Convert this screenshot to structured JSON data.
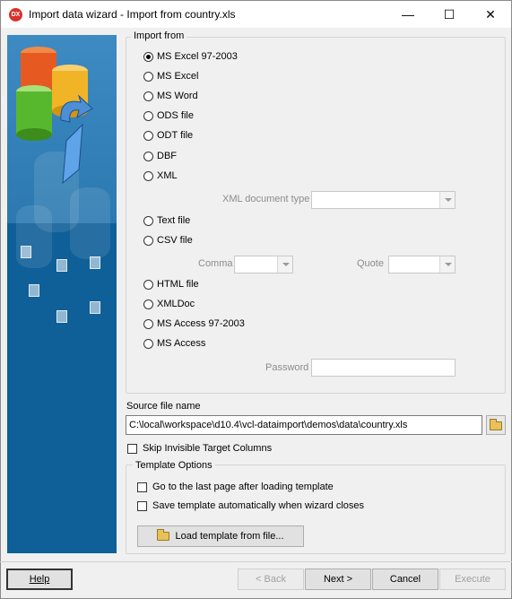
{
  "window": {
    "title": "Import data wizard - Import from country.xls",
    "app_icon": "DX",
    "minimize_icon": "minimize-icon",
    "maximize_icon": "maximize-icon",
    "close_icon": "close-icon"
  },
  "import_from": {
    "legend": "Import from",
    "options": [
      {
        "label": "MS Excel 97-2003",
        "checked": true
      },
      {
        "label": "MS Excel",
        "checked": false
      },
      {
        "label": "MS Word",
        "checked": false
      },
      {
        "label": "ODS file",
        "checked": false
      },
      {
        "label": "ODT file",
        "checked": false
      },
      {
        "label": "DBF",
        "checked": false
      },
      {
        "label": "XML",
        "checked": false
      },
      {
        "label": "Text file",
        "checked": false
      },
      {
        "label": "CSV file",
        "checked": false
      },
      {
        "label": "HTML file",
        "checked": false
      },
      {
        "label": "XMLDoc",
        "checked": false
      },
      {
        "label": "MS Access 97-2003",
        "checked": false
      },
      {
        "label": "MS Access",
        "checked": false
      }
    ],
    "xml_document_type_label": "XML document type",
    "xml_document_type_value": "",
    "comma_label": "Comma",
    "comma_value": "",
    "quote_label": "Quote",
    "quote_value": "",
    "password_label": "Password",
    "password_value": ""
  },
  "source": {
    "label": "Source file name",
    "value": "C:\\local\\workspace\\d10.4\\vcl-dataimport\\demos\\data\\country.xls",
    "browse_icon": "folder-open-icon"
  },
  "skip_invisible": {
    "label": "Skip Invisible Target Columns",
    "checked": false
  },
  "template_options": {
    "legend": "Template Options",
    "go_last_page": {
      "label": "Go to the last page after loading template",
      "checked": false
    },
    "save_auto": {
      "label": "Save template automatically when wizard closes",
      "checked": false
    },
    "load_button": "Load template from file..."
  },
  "footer": {
    "help": "Help",
    "back": "< Back",
    "next": "Next >",
    "cancel": "Cancel",
    "execute": "Execute"
  },
  "colors": {
    "banner_blue": "#1d68a1",
    "window_bg": "#f0f0f0"
  }
}
